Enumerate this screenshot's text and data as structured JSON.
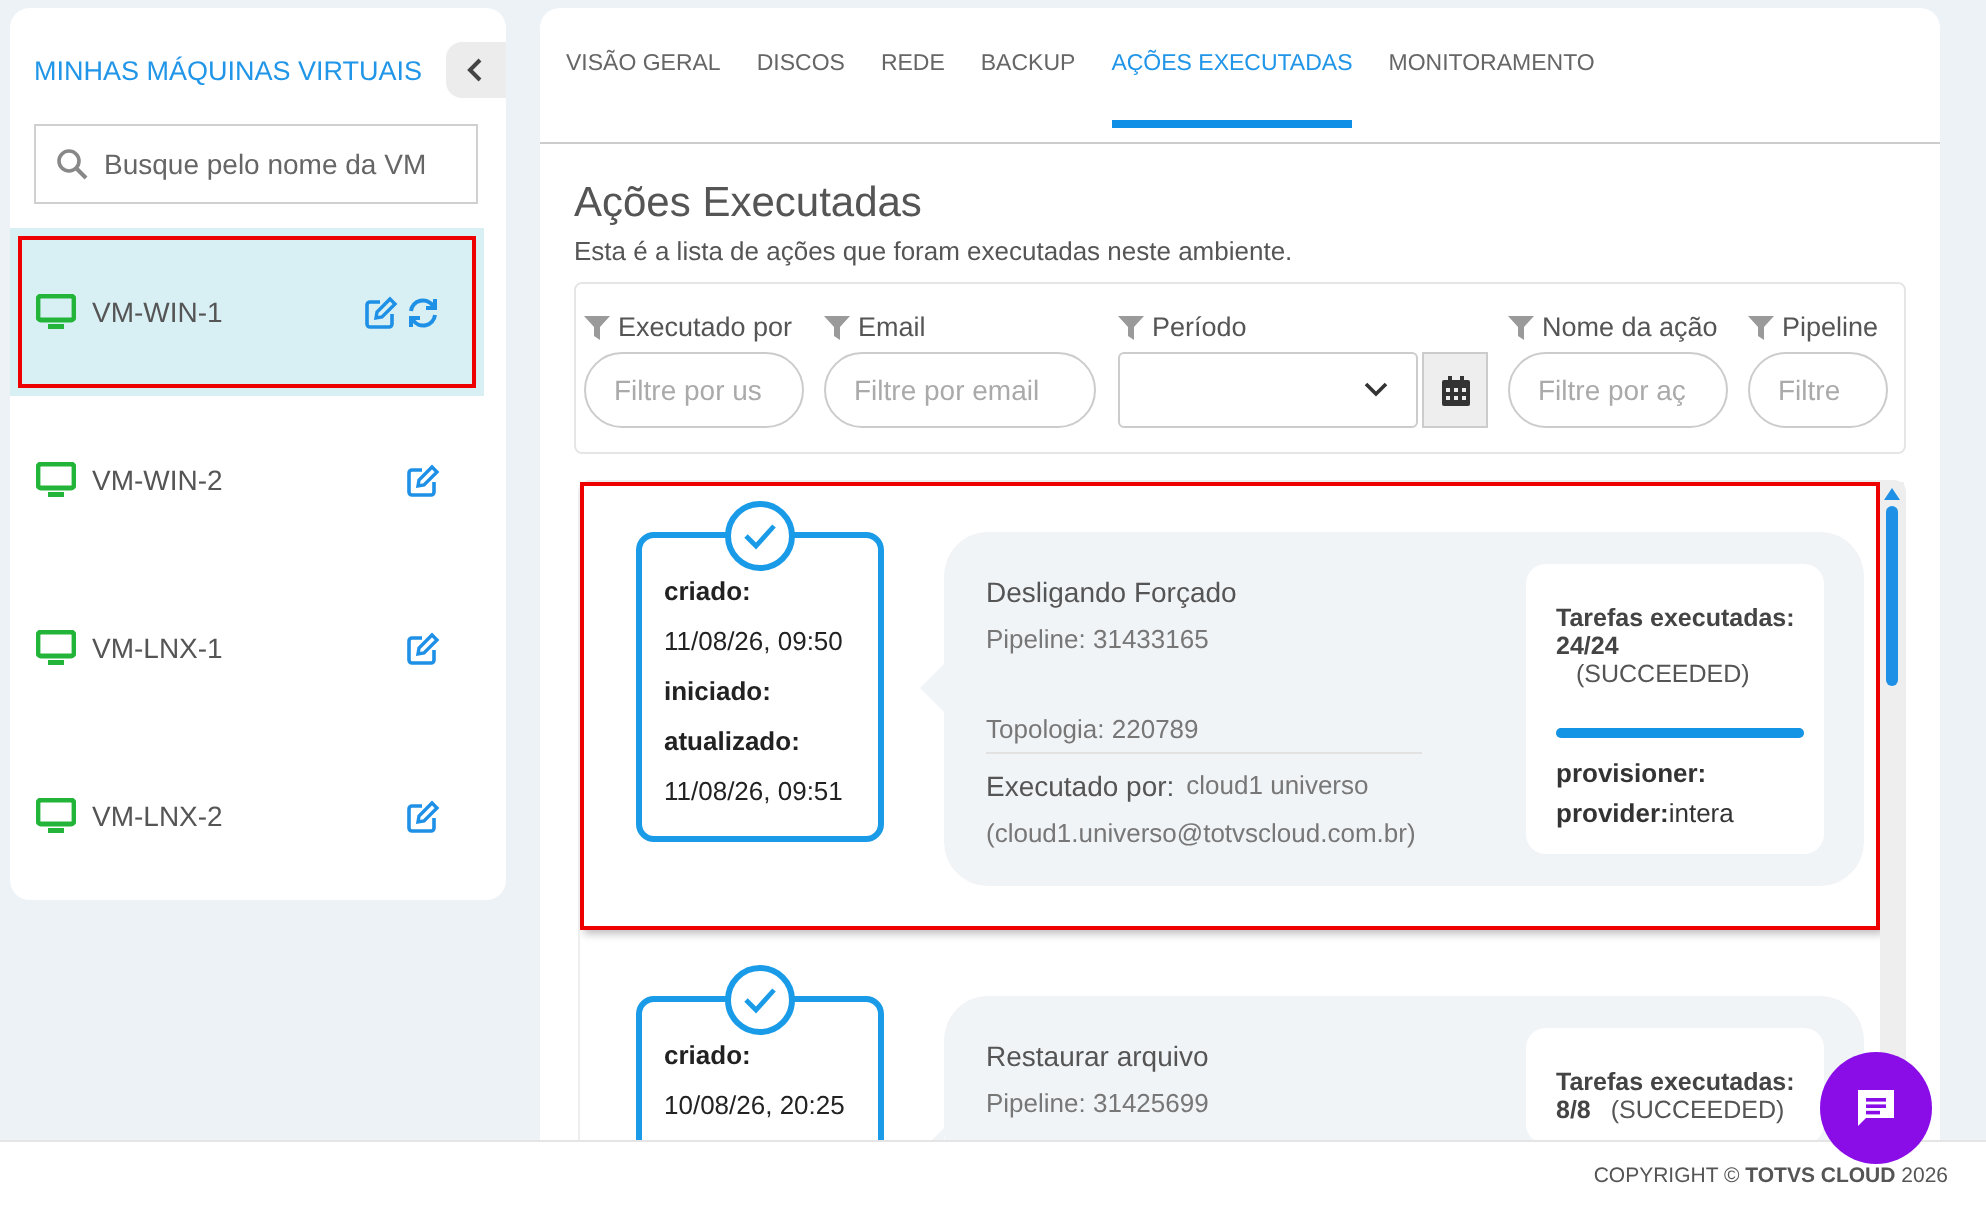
{
  "sidebar": {
    "title": "MINHAS MÁQUINAS VIRTUAIS",
    "search": {
      "placeholder": "Busque pelo nome da VM"
    },
    "vms": [
      {
        "name": "VM-WIN-1",
        "selected": true,
        "highlighted": true,
        "syncing": true
      },
      {
        "name": "VM-WIN-2",
        "selected": false,
        "highlighted": false,
        "syncing": false
      },
      {
        "name": "VM-LNX-1",
        "selected": false,
        "highlighted": false,
        "syncing": false
      },
      {
        "name": "VM-LNX-2",
        "selected": false,
        "highlighted": false,
        "syncing": false
      }
    ]
  },
  "tabs": [
    {
      "label": "VISÃO GERAL",
      "selected": false
    },
    {
      "label": "DISCOS",
      "selected": false
    },
    {
      "label": "REDE",
      "selected": false
    },
    {
      "label": "BACKUP",
      "selected": false
    },
    {
      "label": "AÇÕES EXECUTADAS",
      "selected": true
    },
    {
      "label": "MONITORAMENTO",
      "selected": false
    }
  ],
  "page": {
    "title": "Ações Executadas",
    "subtitle": "Esta é a lista de ações que foram executadas neste ambiente."
  },
  "filters": [
    {
      "kind": "text",
      "label": "Executado por",
      "placeholder": "Filtre por us"
    },
    {
      "kind": "text",
      "label": "Email",
      "placeholder": "Filtre por email"
    },
    {
      "kind": "date",
      "label": "Período"
    },
    {
      "kind": "text",
      "label": "Nome da ação",
      "placeholder": "Filtre por aç"
    },
    {
      "kind": "text",
      "label": "Pipeline",
      "placeholder": "Filtre"
    }
  ],
  "actions": [
    {
      "highlighted": true,
      "timeline": [
        {
          "label": "criado:",
          "value": "11/08/26, 09:50"
        },
        {
          "label": "iniciado:"
        },
        {
          "label": "atualizado:",
          "value": "11/08/26, 09:51"
        }
      ],
      "name": "Desligando Forçado",
      "pipeline": "Pipeline: 31433165",
      "topology": "Topologia: 220789",
      "executed_by_label": "Executado por:",
      "executed_by": "cloud1 universo",
      "email": "(cloud1.universo@totvscloud.com.br)",
      "tasks_label": "Tarefas executadas:",
      "tasks_count": "24/24",
      "tasks_status": "(SUCCEEDED)",
      "level": 1,
      "meta": [
        {
          "label": "provisioner:"
        },
        {
          "label": "provider:",
          "value": "intera"
        }
      ]
    },
    {
      "highlighted": false,
      "timeline": [
        {
          "label": "criado:",
          "value": "10/08/26, 20:25"
        }
      ],
      "name": "Restaurar arquivo",
      "pipeline": "Pipeline: 31425699",
      "tasks_label": "Tarefas executadas:",
      "tasks_count": "8/8",
      "tasks_status": "(SUCCEEDED)"
    }
  ],
  "footer": "COPYRIGHT © **TOTVS CLOUD** 2026"
}
